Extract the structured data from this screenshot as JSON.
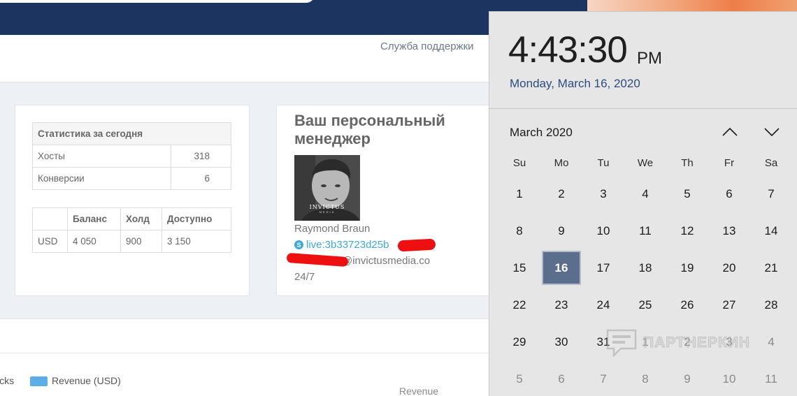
{
  "header": {
    "support_link": "Служба поддержки"
  },
  "stats": {
    "title": "Статистика за сегодня",
    "rows": [
      {
        "label": "Хосты",
        "value": "318"
      },
      {
        "label": "Конверсии",
        "value": "6"
      }
    ]
  },
  "balance": {
    "columns": [
      "",
      "Баланс",
      "Холд",
      "Доступно"
    ],
    "rows": [
      {
        "currency": "USD",
        "balance": "4 050",
        "hold": "900",
        "available": "3 150"
      }
    ]
  },
  "manager": {
    "title": "Ваш персональный менеджер",
    "avatar_logo": "INVICTUS",
    "avatar_sub": "MEDIA",
    "name": "Raymond Braun",
    "skype": "live:3b33723d25b",
    "email_domain": "@invictusmedia.co",
    "hours": "24/7"
  },
  "chart": {
    "legend_partial": "icks",
    "legend_revenue": "Revenue (USD)",
    "axis_label": "Revenue"
  },
  "clock": {
    "time": "4:43:30",
    "ampm": "PM",
    "date": "Monday, March 16, 2020"
  },
  "calendar": {
    "month": "March 2020",
    "weekdays": [
      "Su",
      "Mo",
      "Tu",
      "We",
      "Th",
      "Fr",
      "Sa"
    ],
    "weeks": [
      [
        "1",
        "2",
        "3",
        "4",
        "5",
        "6",
        "7"
      ],
      [
        "8",
        "9",
        "10",
        "11",
        "12",
        "13",
        "14"
      ],
      [
        "15",
        "16",
        "17",
        "18",
        "19",
        "20",
        "21"
      ],
      [
        "22",
        "23",
        "24",
        "25",
        "26",
        "27",
        "28"
      ],
      [
        "29",
        "30",
        "31",
        "1",
        "2",
        "3",
        "4"
      ],
      [
        "5",
        "6",
        "7",
        "8",
        "9",
        "10",
        "11"
      ]
    ],
    "today": "16"
  },
  "watermark": {
    "text": "ПАРТНЕРКИН"
  },
  "colors": {
    "header_bg": "#1b3560",
    "accent_link": "#3fa9d8",
    "today_bg": "#5b6f8c",
    "legend_revenue": "#5dade6"
  }
}
